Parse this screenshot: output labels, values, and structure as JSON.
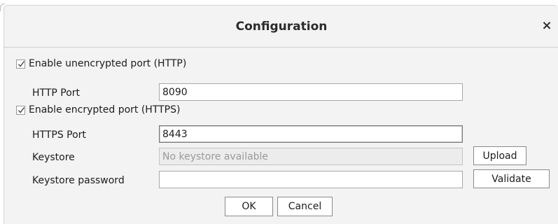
{
  "dialog": {
    "title": "Configuration",
    "close_glyph": "×"
  },
  "http": {
    "enable_label": "Enable unencrypted port (HTTP)",
    "enabled": true,
    "port_label": "HTTP Port",
    "port_value": "8090"
  },
  "https": {
    "enable_label": "Enable encrypted port (HTTPS)",
    "enabled": true,
    "port_label": "HTTPS Port",
    "port_value": "8443",
    "keystore_label": "Keystore",
    "keystore_placeholder": "No keystore available",
    "upload_label": "Upload",
    "password_label": "Keystore password",
    "password_value": "",
    "validate_label": "Validate"
  },
  "footer": {
    "ok_label": "OK",
    "cancel_label": "Cancel"
  },
  "icons": {
    "checkbox": "checkmark-icon",
    "close": "close-icon"
  }
}
